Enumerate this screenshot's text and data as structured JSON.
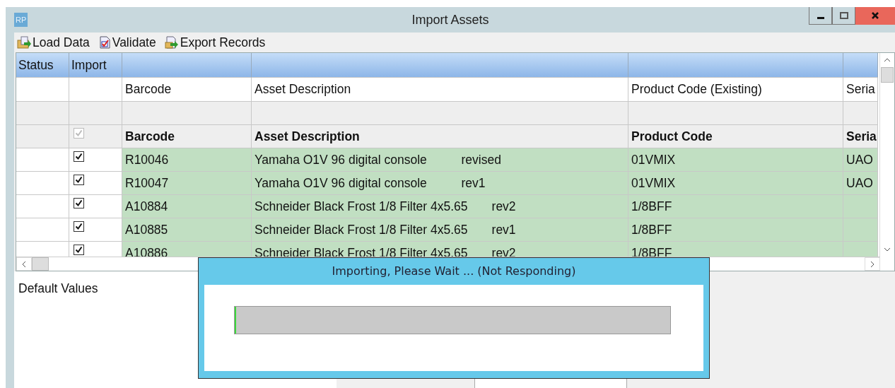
{
  "window": {
    "badge": "RP",
    "title": "Import Assets"
  },
  "toolbar": [
    {
      "kind": "load",
      "label": "Load Data"
    },
    {
      "kind": "validate",
      "label": "Validate"
    },
    {
      "kind": "export",
      "label": "Export Records"
    }
  ],
  "table": {
    "columns": [
      {
        "header": "Status"
      },
      {
        "header": "Import"
      },
      {
        "mapping": "Barcode",
        "field": "Barcode"
      },
      {
        "mapping": "Asset Description",
        "field": "Asset Description"
      },
      {
        "mapping": "Product Code (Existing)",
        "field": "Product Code"
      },
      {
        "mapping": "Seria",
        "field": "Seria"
      }
    ],
    "select_all": {
      "checked": true,
      "disabled": true
    },
    "rows": [
      {
        "import": true,
        "barcode": "R10046",
        "description": "Yamaha O1V 96 digital console          revised",
        "product_code": "01VMIX",
        "column_6": "UAO"
      },
      {
        "import": true,
        "barcode": "R10047",
        "description": "Yamaha O1V 96 digital console          rev1",
        "product_code": "01VMIX",
        "column_6": "UAO"
      },
      {
        "import": true,
        "barcode": "A10884",
        "description": "Schneider Black Frost 1/8 Filter 4x5.65       rev2",
        "product_code": "1/8BFF"
      },
      {
        "import": true,
        "barcode": "A10885",
        "description": "Schneider Black Frost 1/8 Filter 4x5.65       rev1",
        "product_code": "1/8BFF"
      },
      {
        "import": true,
        "barcode": "A10886",
        "description": "Schneider Black Frost 1/8 Filter 4x5.65       rev2",
        "product_code": "1/8BFF"
      }
    ]
  },
  "defaults_panel": {
    "title": "Default Values"
  },
  "dialog": {
    "title": "Importing, Please Wait ... (Not Responding)",
    "progress": {
      "level": 0.003
    }
  }
}
